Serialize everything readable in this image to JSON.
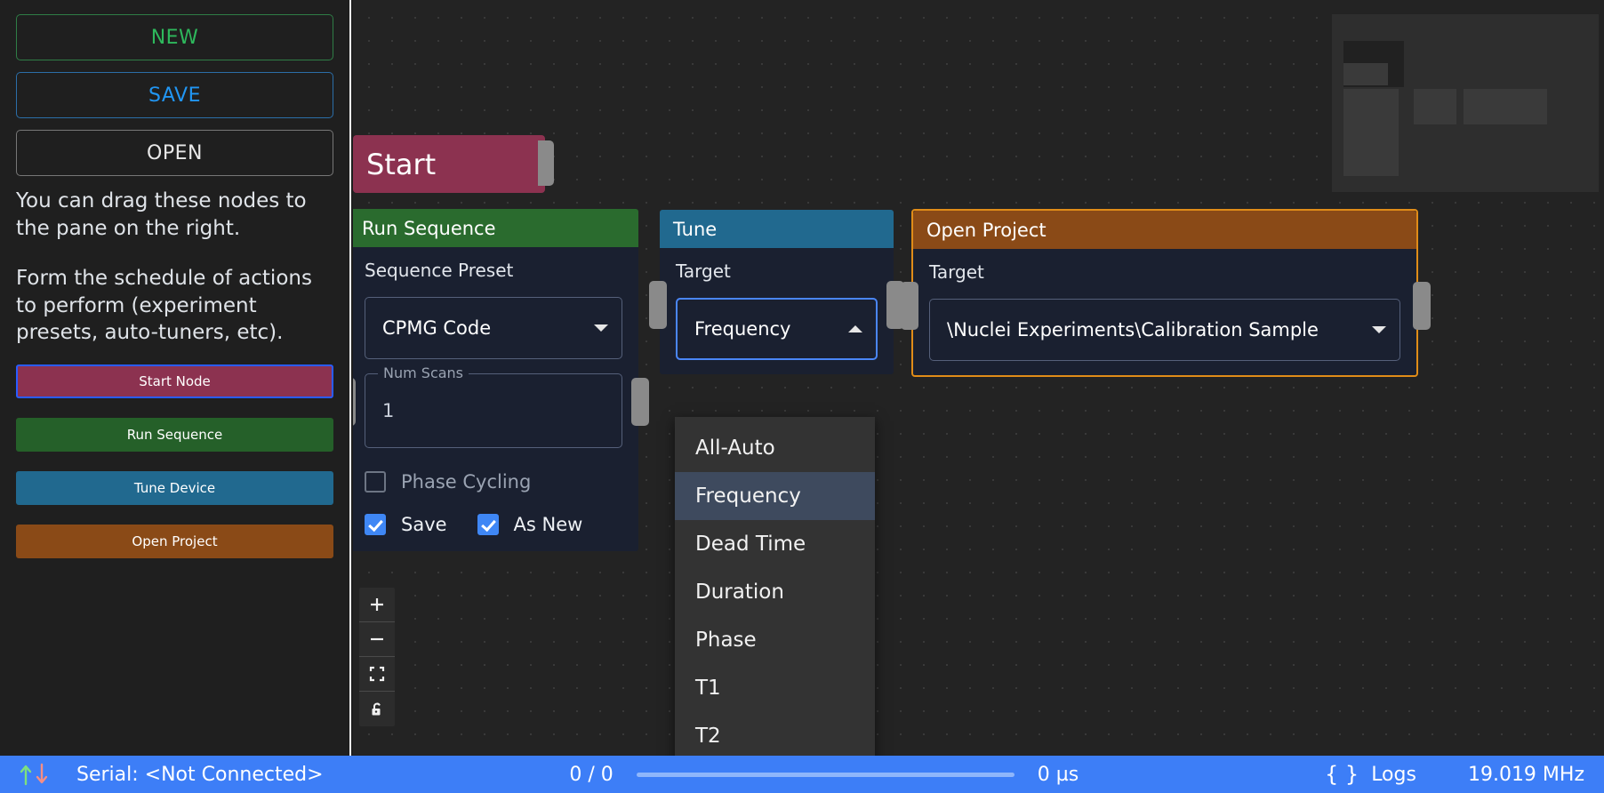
{
  "sidebar": {
    "buttons": [
      {
        "label": "NEW",
        "name": "new-button"
      },
      {
        "label": "SAVE",
        "name": "save-button"
      },
      {
        "label": "OPEN",
        "name": "open-button"
      }
    ],
    "blurb1": "You can drag these nodes to the pane on the right.",
    "blurb2": "Form the schedule of actions to perform (experiment presets, auto-tuners, etc).",
    "node_palette": [
      {
        "label": "Start Node",
        "color": "#8c3250",
        "selected": true
      },
      {
        "label": "Run Sequence",
        "color": "#256029",
        "selected": false
      },
      {
        "label": "Tune Device",
        "color": "#21698f",
        "selected": false
      },
      {
        "label": "Open Project",
        "color": "#8a4a17",
        "selected": false
      }
    ]
  },
  "canvas": {
    "nodes": {
      "start": {
        "title": "Start"
      },
      "run_sequence": {
        "title": "Run Sequence",
        "preset_label": "Sequence Preset",
        "preset_value": "CPMG Code",
        "num_scans_label": "Num Scans",
        "num_scans_value": "1",
        "phase_cycling_label": "Phase Cycling",
        "phase_cycling_checked": false,
        "save_label": "Save",
        "save_checked": true,
        "as_new_label": "As New",
        "as_new_checked": true
      },
      "tune": {
        "title": "Tune",
        "target_label": "Target",
        "target_value": "Frequency",
        "dropdown_open": true,
        "options": [
          {
            "label": "All-Auto",
            "selected": false
          },
          {
            "label": "Frequency",
            "selected": true
          },
          {
            "label": "Dead Time",
            "selected": false
          },
          {
            "label": "Duration",
            "selected": false
          },
          {
            "label": "Phase",
            "selected": false
          },
          {
            "label": "T1",
            "selected": false
          },
          {
            "label": "T2",
            "selected": false
          }
        ]
      },
      "open_project": {
        "title": "Open Project",
        "target_label": "Target",
        "target_value": "\\Nuclei Experiments\\Calibration Sample"
      }
    },
    "zoom_controls": [
      {
        "name": "zoom-in-icon"
      },
      {
        "name": "zoom-out-icon"
      },
      {
        "name": "fit-view-icon"
      },
      {
        "name": "unlock-icon"
      }
    ]
  },
  "statusbar": {
    "serial": "Serial: <Not Connected>",
    "count": "0 / 0",
    "time": "0 µs",
    "logs": "Logs",
    "frequency": "19.019 MHz",
    "progress_percent": 0,
    "accent": "#3d7ef7"
  }
}
